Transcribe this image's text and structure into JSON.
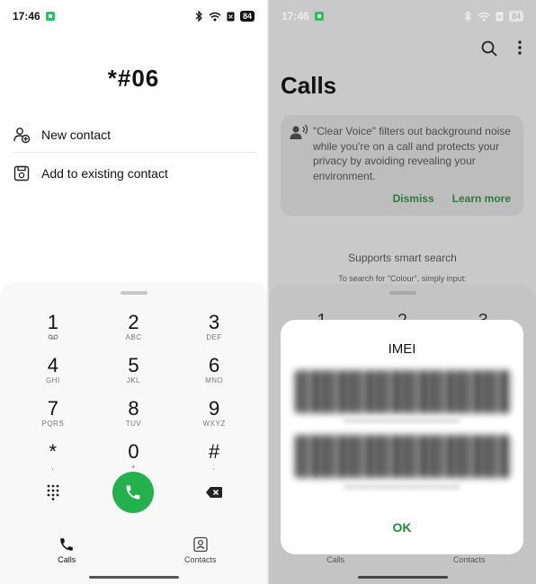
{
  "status": {
    "time": "17:46",
    "battery": "84"
  },
  "dialer": {
    "number": "*#06",
    "menu": [
      {
        "label": "New contact",
        "icon": "add-person-icon"
      },
      {
        "label": "Add to existing contact",
        "icon": "save-contact-icon"
      }
    ],
    "keys": [
      {
        "digit": "1",
        "letters": ""
      },
      {
        "digit": "2",
        "letters": "ABC"
      },
      {
        "digit": "3",
        "letters": "DEF"
      },
      {
        "digit": "4",
        "letters": "GHI"
      },
      {
        "digit": "5",
        "letters": "JKL"
      },
      {
        "digit": "6",
        "letters": "MNO"
      },
      {
        "digit": "7",
        "letters": "PQRS"
      },
      {
        "digit": "8",
        "letters": "TUV"
      },
      {
        "digit": "9",
        "letters": "WXYZ"
      },
      {
        "digit": "*",
        "letters": ","
      },
      {
        "digit": "0",
        "letters": "+"
      },
      {
        "digit": "#",
        "letters": ";"
      }
    ]
  },
  "nav": {
    "calls": "Calls",
    "contacts": "Contacts"
  },
  "calls_screen": {
    "title": "Calls",
    "tip": "\"Clear Voice\" filters out background noise while you're on a call and protects your privacy by avoiding revealing your environment.",
    "dismiss": "Dismiss",
    "learn_more": "Learn more",
    "smart_search": "Supports smart search",
    "smart_hint": "To search for \"Colour\", simply input:",
    "peek_digits": [
      "1",
      "2",
      "3"
    ]
  },
  "dialog": {
    "title": "IMEI",
    "ok": "OK"
  },
  "colors": {
    "accent_green": "#22b14c",
    "link_green": "#1f8a3a"
  }
}
